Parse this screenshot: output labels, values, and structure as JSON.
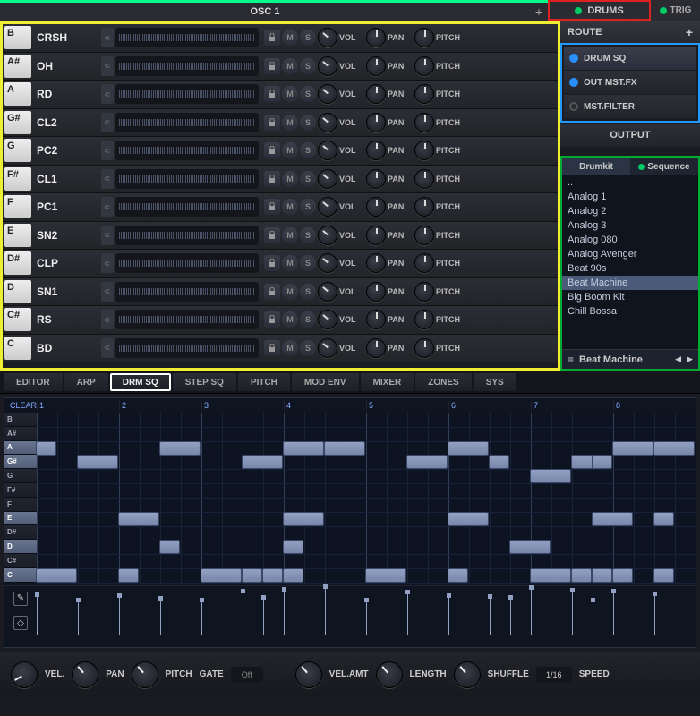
{
  "topbar": {
    "osc_title": "OSC 1",
    "drums_label": "DRUMS",
    "trig_label": "TRIG"
  },
  "slots": [
    {
      "key": "B",
      "name": "CRSH",
      "vol": "VOL",
      "pan": "PAN",
      "pitch": "PITCH"
    },
    {
      "key": "A#",
      "name": "OH",
      "vol": "VOL",
      "pan": "PAN",
      "pitch": "PITCH"
    },
    {
      "key": "A",
      "name": "RD",
      "vol": "VOL",
      "pan": "PAN",
      "pitch": "PITCH"
    },
    {
      "key": "G#",
      "name": "CL2",
      "vol": "VOL",
      "pan": "PAN",
      "pitch": "PITCH"
    },
    {
      "key": "G",
      "name": "PC2",
      "vol": "VOL",
      "pan": "PAN",
      "pitch": "PITCH"
    },
    {
      "key": "F#",
      "name": "CL1",
      "vol": "VOL",
      "pan": "PAN",
      "pitch": "PITCH"
    },
    {
      "key": "F",
      "name": "PC1",
      "vol": "VOL",
      "pan": "PAN",
      "pitch": "PITCH"
    },
    {
      "key": "E",
      "name": "SN2",
      "vol": "VOL",
      "pan": "PAN",
      "pitch": "PITCH"
    },
    {
      "key": "D#",
      "name": "CLP",
      "vol": "VOL",
      "pan": "PAN",
      "pitch": "PITCH"
    },
    {
      "key": "D",
      "name": "SN1",
      "vol": "VOL",
      "pan": "PAN",
      "pitch": "PITCH"
    },
    {
      "key": "C#",
      "name": "RS",
      "vol": "VOL",
      "pan": "PAN",
      "pitch": "PITCH"
    },
    {
      "key": "C",
      "name": "BD",
      "vol": "VOL",
      "pan": "PAN",
      "pitch": "PITCH"
    }
  ],
  "route": {
    "header": "ROUTE",
    "items": [
      {
        "label": "DRUM SQ",
        "on": true
      },
      {
        "label": "OUT MST.FX",
        "on": true
      },
      {
        "label": "MST.FILTER",
        "on": false
      }
    ],
    "output": "OUTPUT"
  },
  "browser": {
    "tabs": {
      "drumkit": "Drumkit",
      "sequence": "Sequence"
    },
    "items": [
      "..",
      "Analog 1",
      "Analog 2",
      "Analog 3",
      "Analog 080",
      "Analog Avenger",
      "Beat 90s",
      "Beat Machine",
      "Big Boom Kit",
      "Chill Bossa"
    ],
    "selected": "Beat Machine",
    "footer": "Beat Machine"
  },
  "tabs": [
    "EDITOR",
    "ARP",
    "DRM SQ",
    "STEP SQ",
    "PITCH",
    "MOD ENV",
    "MIXER",
    "ZONES",
    "SYS"
  ],
  "tab_selected": 2,
  "seq": {
    "clear": "CLEAR",
    "bars": [
      "1",
      "2",
      "3",
      "4",
      "5",
      "6",
      "7",
      "8"
    ],
    "keys": [
      "B",
      "A#",
      "A",
      "G#",
      "G",
      "F#",
      "F",
      "E",
      "D#",
      "D",
      "C#",
      "C"
    ],
    "lit_keys": [
      "A",
      "G#",
      "E",
      "D",
      "C"
    ],
    "notes": [
      {
        "row": 2,
        "col": 0,
        "len": 1
      },
      {
        "row": 2,
        "col": 6,
        "len": 2
      },
      {
        "row": 2,
        "col": 12,
        "len": 2
      },
      {
        "row": 2,
        "col": 14,
        "len": 2
      },
      {
        "row": 2,
        "col": 20,
        "len": 2
      },
      {
        "row": 2,
        "col": 28,
        "len": 2
      },
      {
        "row": 2,
        "col": 30,
        "len": 2
      },
      {
        "row": 3,
        "col": 2,
        "len": 2
      },
      {
        "row": 3,
        "col": 10,
        "len": 2
      },
      {
        "row": 3,
        "col": 18,
        "len": 2
      },
      {
        "row": 3,
        "col": 22,
        "len": 1
      },
      {
        "row": 3,
        "col": 26,
        "len": 2
      },
      {
        "row": 3,
        "col": 27,
        "len": 1
      },
      {
        "row": 4,
        "col": 24,
        "len": 2
      },
      {
        "row": 7,
        "col": 4,
        "len": 2
      },
      {
        "row": 7,
        "col": 12,
        "len": 2
      },
      {
        "row": 7,
        "col": 20,
        "len": 2
      },
      {
        "row": 7,
        "col": 27,
        "len": 2
      },
      {
        "row": 7,
        "col": 30,
        "len": 1
      },
      {
        "row": 9,
        "col": 6,
        "len": 1
      },
      {
        "row": 9,
        "col": 12,
        "len": 1
      },
      {
        "row": 9,
        "col": 23,
        "len": 2
      },
      {
        "row": 11,
        "col": 0,
        "len": 2
      },
      {
        "row": 11,
        "col": 4,
        "len": 1
      },
      {
        "row": 11,
        "col": 8,
        "len": 2
      },
      {
        "row": 11,
        "col": 10,
        "len": 1
      },
      {
        "row": 11,
        "col": 11,
        "len": 1
      },
      {
        "row": 11,
        "col": 12,
        "len": 1
      },
      {
        "row": 11,
        "col": 16,
        "len": 2
      },
      {
        "row": 11,
        "col": 20,
        "len": 1
      },
      {
        "row": 11,
        "col": 24,
        "len": 2
      },
      {
        "row": 11,
        "col": 26,
        "len": 1
      },
      {
        "row": 11,
        "col": 27,
        "len": 1
      },
      {
        "row": 11,
        "col": 28,
        "len": 1
      },
      {
        "row": 11,
        "col": 30,
        "len": 1
      }
    ]
  },
  "bottom": {
    "vel": "VEL.",
    "pan": "PAN",
    "pitch": "PITCH",
    "gate": "GATE",
    "gate_val": "Off",
    "velamt": "VEL.AMT",
    "length": "LENGTH",
    "shuffle": "SHUFFLE",
    "speed_val": "1/16",
    "speed": "SPEED"
  }
}
